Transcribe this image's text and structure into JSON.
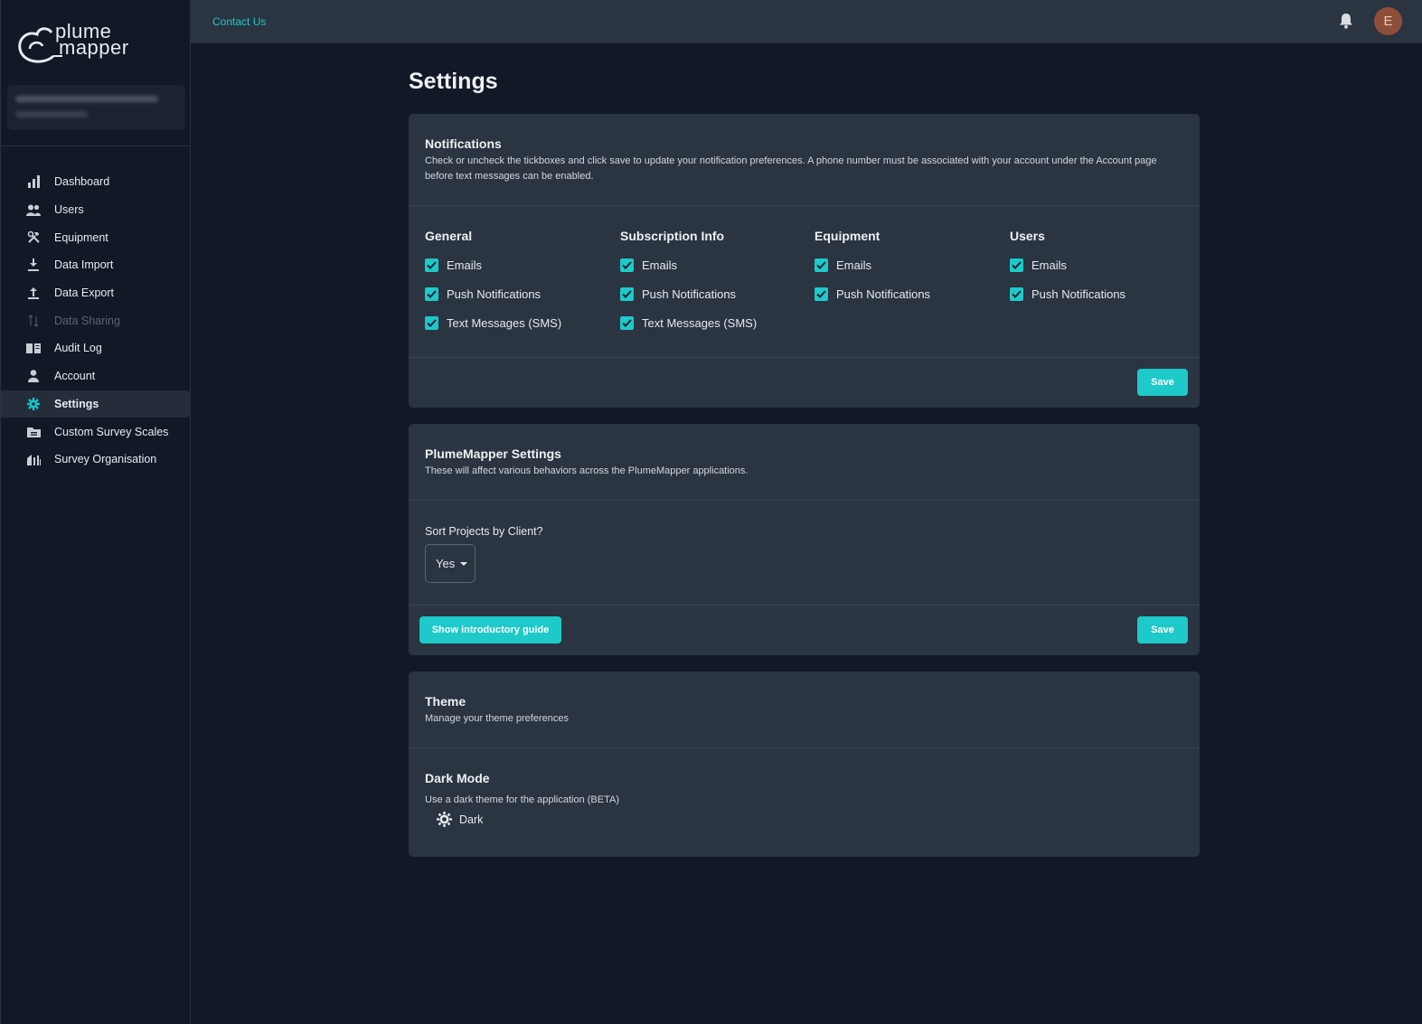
{
  "app": {
    "logo_line1": "plume",
    "logo_line2": "mapper",
    "accent": "#1dc9c9"
  },
  "topbar": {
    "contact_label": "Contact Us",
    "avatar_initial": "E"
  },
  "sidebar": {
    "items": [
      {
        "label": "Dashboard",
        "icon": "bar-chart-icon",
        "state": "normal"
      },
      {
        "label": "Users",
        "icon": "users-icon",
        "state": "normal"
      },
      {
        "label": "Equipment",
        "icon": "tools-icon",
        "state": "normal"
      },
      {
        "label": "Data Import",
        "icon": "download-icon",
        "state": "normal"
      },
      {
        "label": "Data Export",
        "icon": "upload-icon",
        "state": "normal"
      },
      {
        "label": "Data Sharing",
        "icon": "swap-icon",
        "state": "disabled"
      },
      {
        "label": "Audit Log",
        "icon": "book-icon",
        "state": "normal"
      },
      {
        "label": "Account",
        "icon": "person-icon",
        "state": "normal"
      },
      {
        "label": "Settings",
        "icon": "gear-icon",
        "state": "active"
      },
      {
        "label": "Custom Survey Scales",
        "icon": "folder-icon",
        "state": "normal"
      },
      {
        "label": "Survey Organisation",
        "icon": "building-icon",
        "state": "normal"
      }
    ]
  },
  "page": {
    "title": "Settings"
  },
  "notifications": {
    "title": "Notifications",
    "description": "Check or uncheck the tickboxes and click save to update your notification preferences. A phone number must be associated with your account under the Account page before text messages can be enabled.",
    "columns": [
      {
        "title": "General",
        "options": [
          "Emails",
          "Push Notifications",
          "Text Messages (SMS)"
        ]
      },
      {
        "title": "Subscription Info",
        "options": [
          "Emails",
          "Push Notifications",
          "Text Messages (SMS)"
        ]
      },
      {
        "title": "Equipment",
        "options": [
          "Emails",
          "Push Notifications"
        ]
      },
      {
        "title": "Users",
        "options": [
          "Emails",
          "Push Notifications"
        ]
      }
    ],
    "save_label": "Save"
  },
  "plumemapper": {
    "title": "PlumeMapper Settings",
    "description": "These will affect various behaviors across the PlumeMapper applications.",
    "sort_label": "Sort Projects by Client?",
    "sort_value": "Yes",
    "guide_label": "Show introductory guide",
    "save_label": "Save"
  },
  "theme": {
    "title": "Theme",
    "description": "Manage your theme preferences",
    "dark_title": "Dark Mode",
    "dark_desc": "Use a dark theme for the application (BETA)",
    "dark_value": "Dark"
  }
}
